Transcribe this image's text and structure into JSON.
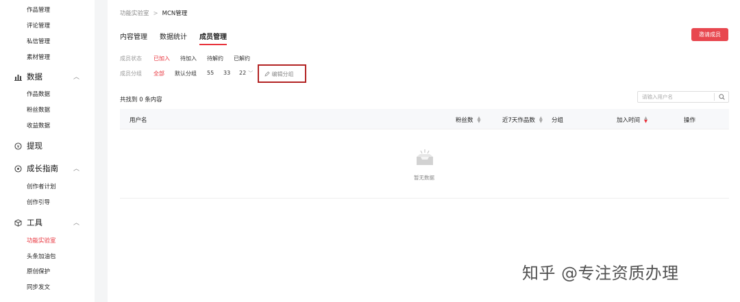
{
  "sidebar": {
    "top_items": [
      {
        "label": "作品管理"
      },
      {
        "label": "评论管理"
      },
      {
        "label": "私信管理"
      },
      {
        "label": "素材管理"
      }
    ],
    "sections": [
      {
        "title": "数据",
        "icon": "bar-chart-icon",
        "items": [
          {
            "label": "作品数据"
          },
          {
            "label": "粉丝数据"
          },
          {
            "label": "收益数据"
          }
        ]
      },
      {
        "title": "提现",
        "icon": "coin-icon",
        "items": []
      },
      {
        "title": "成长指南",
        "icon": "compass-icon",
        "items": [
          {
            "label": "创作者计划"
          },
          {
            "label": "创作引导"
          }
        ]
      },
      {
        "title": "工具",
        "icon": "cube-icon",
        "items": [
          {
            "label": "功能实验室",
            "active": true
          },
          {
            "label": "头条加油包"
          },
          {
            "label": "原创保护"
          },
          {
            "label": "同步发文"
          }
        ]
      }
    ]
  },
  "breadcrumb": {
    "parent": "功能实验室",
    "current": "MCN管理"
  },
  "tabs": [
    {
      "label": "内容管理"
    },
    {
      "label": "数据统计"
    },
    {
      "label": "成员管理",
      "active": true
    }
  ],
  "invite_button": "邀请成员",
  "filters": {
    "status_label": "成员状态",
    "status_options": [
      "已加入",
      "待加入",
      "待解约",
      "已解约"
    ],
    "group_label": "成员分组",
    "group_options": [
      "全部",
      "默认分组",
      "55",
      "33",
      "22"
    ],
    "edit_group": "编辑分组"
  },
  "result_count": "共找到 0 条内容",
  "search": {
    "placeholder": "请输入用户名"
  },
  "table": {
    "columns": [
      "用户名",
      "粉丝数",
      "近7天作品数",
      "分组",
      "加入时间",
      "操作"
    ]
  },
  "empty_text": "暂无数据",
  "watermark": "知乎 @专注资质办理",
  "colors": {
    "accent": "#e8333c",
    "button": "#e8474f",
    "highlight_box": "#b22222"
  }
}
